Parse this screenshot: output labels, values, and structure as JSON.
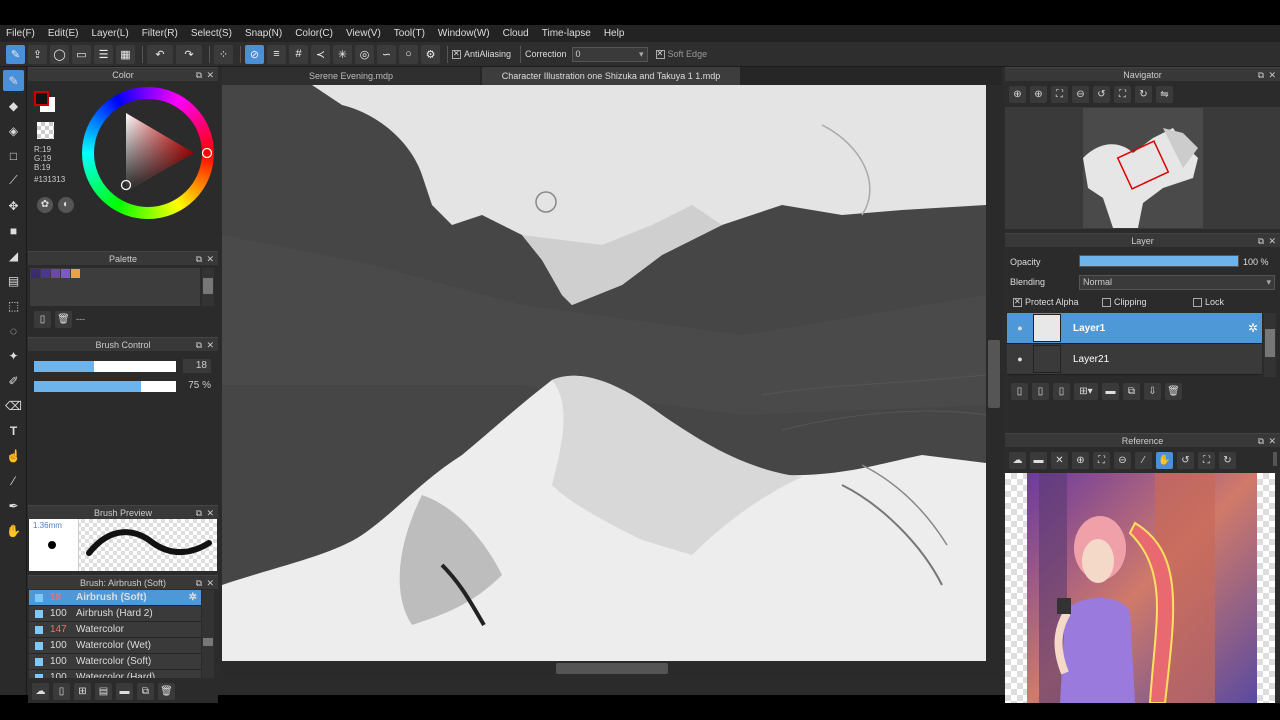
{
  "menu": [
    "File(F)",
    "Edit(E)",
    "Layer(L)",
    "Filter(R)",
    "Select(S)",
    "Snap(N)",
    "Color(C)",
    "View(V)",
    "Tool(T)",
    "Window(W)",
    "Cloud",
    "Time-lapse",
    "Help"
  ],
  "toolbar": {
    "antialiasing": "AntiAliasing",
    "correction_label": "Correction",
    "correction_value": "0",
    "soft_edge": "Soft Edge"
  },
  "color_panel": {
    "title": "Color",
    "r": "R:19",
    "g": "G:19",
    "b": "B:19",
    "hex": "#131313"
  },
  "palette": {
    "title": "Palette",
    "swatches": [
      "#3b2d6b",
      "#4a3a85",
      "#6a4aa3",
      "#7a5cc0",
      "#f0a040"
    ],
    "status": "---"
  },
  "brush_control": {
    "title": "Brush Control",
    "size": "18",
    "opacity": "75 %",
    "size_fill": 0.42,
    "opacity_fill": 0.75
  },
  "brush_preview": {
    "title": "Brush Preview",
    "size": "1.36mm"
  },
  "brush_list": {
    "title": "Brush: Airbrush (Soft)",
    "items": [
      {
        "num": "18",
        "name": "Airbrush (Soft)",
        "red": true,
        "active": true
      },
      {
        "num": "100",
        "name": "Airbrush (Hard 2)",
        "red": false,
        "active": false
      },
      {
        "num": "147",
        "name": "Watercolor",
        "red": true,
        "active": false
      },
      {
        "num": "100",
        "name": "Watercolor (Wet)",
        "red": false,
        "active": false
      },
      {
        "num": "100",
        "name": "Watercolor (Soft)",
        "red": false,
        "active": false
      },
      {
        "num": "100",
        "name": "Watercolor (Hard)",
        "red": false,
        "active": false
      }
    ]
  },
  "doc_tabs": [
    "Serene Evening.mdp",
    "Character Illustration one Shizuka and Takuya 1 1.mdp"
  ],
  "navigator": {
    "title": "Navigator"
  },
  "layer_panel": {
    "title": "Layer",
    "opacity_label": "Opacity",
    "opacity_value": "100 %",
    "opacity_fill": 1.0,
    "blending_label": "Blending",
    "blending_value": "Normal",
    "protect_alpha": "Protect Alpha",
    "clipping": "Clipping",
    "lock": "Lock",
    "layers": [
      {
        "name": "Layer1",
        "active": true
      },
      {
        "name": "Layer21",
        "active": false
      }
    ]
  },
  "reference": {
    "title": "Reference"
  }
}
